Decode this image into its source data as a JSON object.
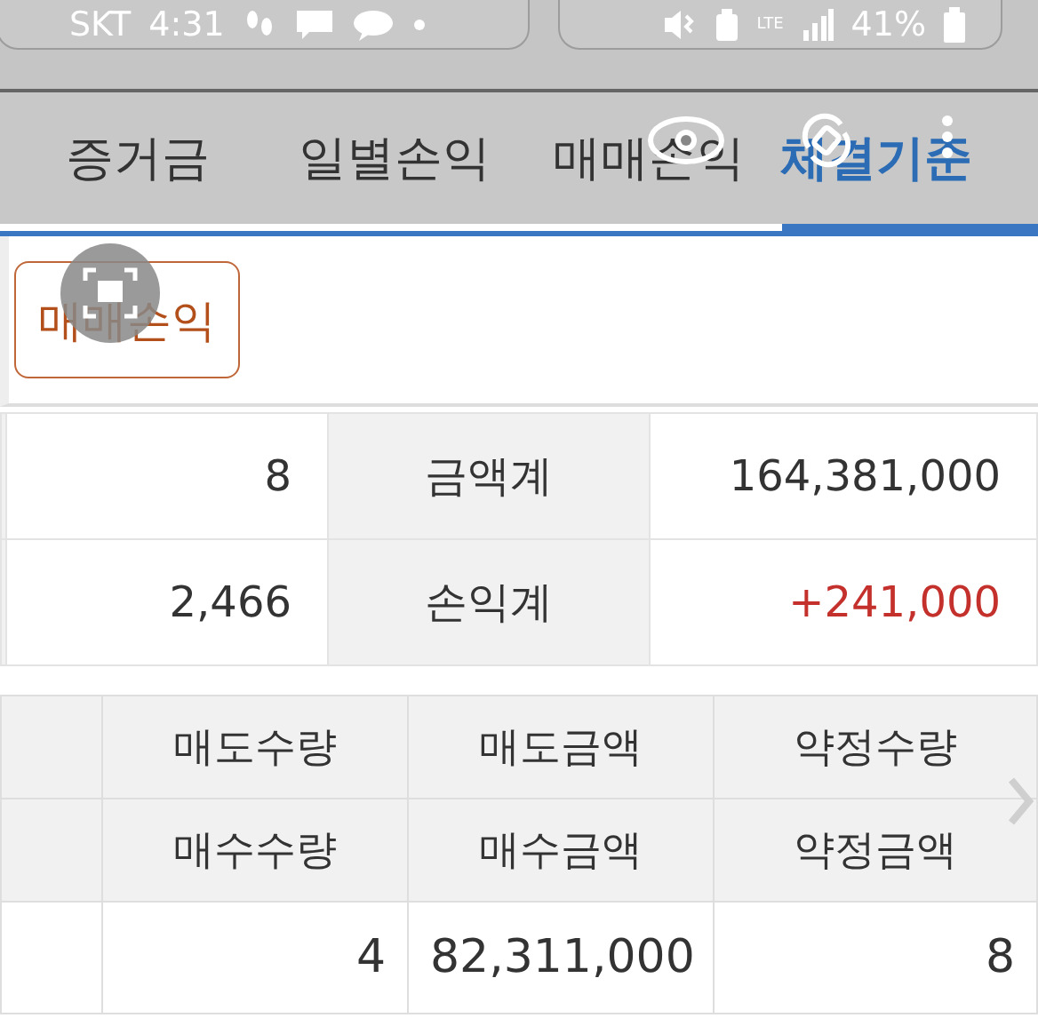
{
  "status_bar": {
    "carrier": "SKT",
    "time": "4:31",
    "network": "LTE",
    "battery": "41%"
  },
  "tabs": [
    {
      "label": "증거금",
      "selected": false
    },
    {
      "label": "일별손익",
      "selected": false
    },
    {
      "label": "매매손익",
      "selected": false
    },
    {
      "label": "체결기준",
      "selected": true
    }
  ],
  "filter_button": {
    "label": "매매손익"
  },
  "summary": {
    "rows": [
      {
        "value": "8",
        "label": "금액계",
        "total": "164,381,000",
        "kind": "plain"
      },
      {
        "value": "2,466",
        "label": "손익계",
        "total": "+241,000",
        "kind": "positive"
      }
    ]
  },
  "table": {
    "header_rows": [
      [
        "매도수량",
        "매도금액",
        "약정수량"
      ],
      [
        "매수수량",
        "매수금액",
        "약정금액"
      ]
    ],
    "rows": [
      [
        "4",
        "82,311,000",
        "8"
      ]
    ]
  }
}
